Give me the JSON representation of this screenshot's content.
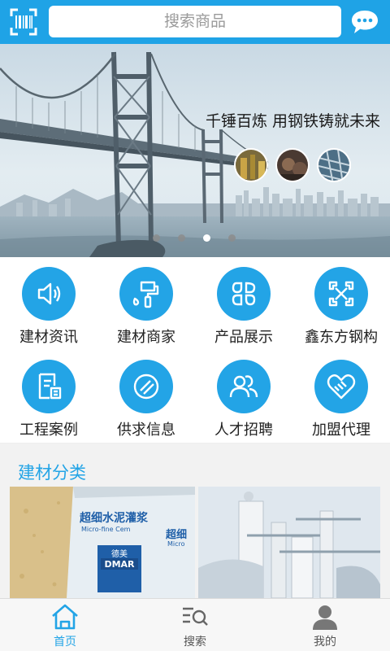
{
  "header": {
    "search_placeholder": "搜索商品",
    "scan_icon": "scan-icon",
    "message_icon": "chat-bubble-icon"
  },
  "banner": {
    "slogan": "千锤百炼  用钢铁铸就未来",
    "slide_count": 4,
    "active_slide": 3
  },
  "grid": {
    "items": [
      {
        "label": "建材资讯",
        "icon": "speaker-icon"
      },
      {
        "label": "建材商家",
        "icon": "paint-brush-icon"
      },
      {
        "label": "产品展示",
        "icon": "grid-four-icon"
      },
      {
        "label": "鑫东方钢构",
        "icon": "network-icon"
      },
      {
        "label": "工程案例",
        "icon": "document-icon"
      },
      {
        "label": "供求信息",
        "icon": "circle-slash-icon"
      },
      {
        "label": "人才招聘",
        "icon": "people-icon"
      },
      {
        "label": "加盟代理",
        "icon": "handshake-heart-icon"
      }
    ]
  },
  "category": {
    "title": "建材分类",
    "product_text_1": "超细水泥灌浆",
    "product_text_2": "Micro-fine Cem",
    "product_text_3": "超细",
    "product_text_4": "Micro",
    "brand_cn": "德美",
    "brand_en": "DMAR"
  },
  "tabbar": {
    "tabs": [
      {
        "label": "首页",
        "icon": "home-icon",
        "active": true
      },
      {
        "label": "搜索",
        "icon": "search-list-icon",
        "active": false
      },
      {
        "label": "我的",
        "icon": "user-icon",
        "active": false
      }
    ]
  },
  "colors": {
    "primary": "#1fa3e6",
    "text": "#222222",
    "muted": "#555555"
  }
}
